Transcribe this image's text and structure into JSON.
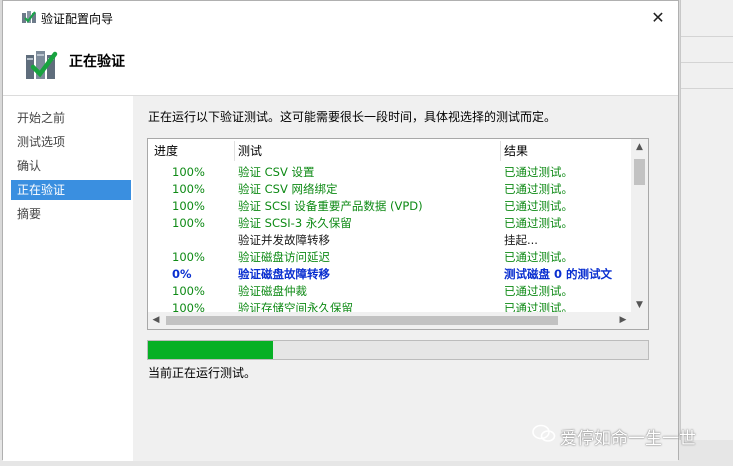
{
  "window": {
    "title": "验证配置向导",
    "close_symbol": "✕"
  },
  "header": {
    "title": "正在验证"
  },
  "sidebar": {
    "items": [
      {
        "label": "开始之前",
        "active": false
      },
      {
        "label": "测试选项",
        "active": false
      },
      {
        "label": "确认",
        "active": false
      },
      {
        "label": "正在验证",
        "active": true
      },
      {
        "label": "摘要",
        "active": false
      }
    ]
  },
  "main": {
    "description": "正在运行以下验证测试。这可能需要很长一段时间，具体视选择的测试而定。",
    "columns": {
      "progress": "进度",
      "test": "测试",
      "result": "结果"
    },
    "rows": [
      {
        "progress": "100%",
        "test": "验证 CSV 设置",
        "result": "已通过测试。",
        "style": "green"
      },
      {
        "progress": "100%",
        "test": "验证 CSV 网络绑定",
        "result": "已通过测试。",
        "style": "green"
      },
      {
        "progress": "100%",
        "test": "验证 SCSI 设备重要产品数据 (VPD)",
        "result": "已通过测试。",
        "style": "green"
      },
      {
        "progress": "100%",
        "test": "验证 SCSI-3 永久保留",
        "result": "已通过测试。",
        "style": "green"
      },
      {
        "progress": "",
        "test": "验证并发故障转移",
        "result": "挂起...",
        "style": "black"
      },
      {
        "progress": "100%",
        "test": "验证磁盘访问延迟",
        "result": "已通过测试。",
        "style": "green"
      },
      {
        "progress": "0%",
        "test": "验证磁盘故障转移",
        "result": "测试磁盘 0 的测试文",
        "style": "blue"
      },
      {
        "progress": "100%",
        "test": "验证磁盘仲裁",
        "result": "已通过测试。",
        "style": "green"
      },
      {
        "progress": "100%",
        "test": "验证存储空间永久保留",
        "result": "已通过测试。",
        "style": "green"
      }
    ],
    "overall_progress": 0.25,
    "status": "当前正在运行测试。"
  },
  "colors": {
    "accent": "#3a8fe0",
    "pass": "#0e8a15",
    "running": "#0a2fd0",
    "progress": "#06b025"
  },
  "watermark": {
    "text": "爱停如命一生一世"
  }
}
